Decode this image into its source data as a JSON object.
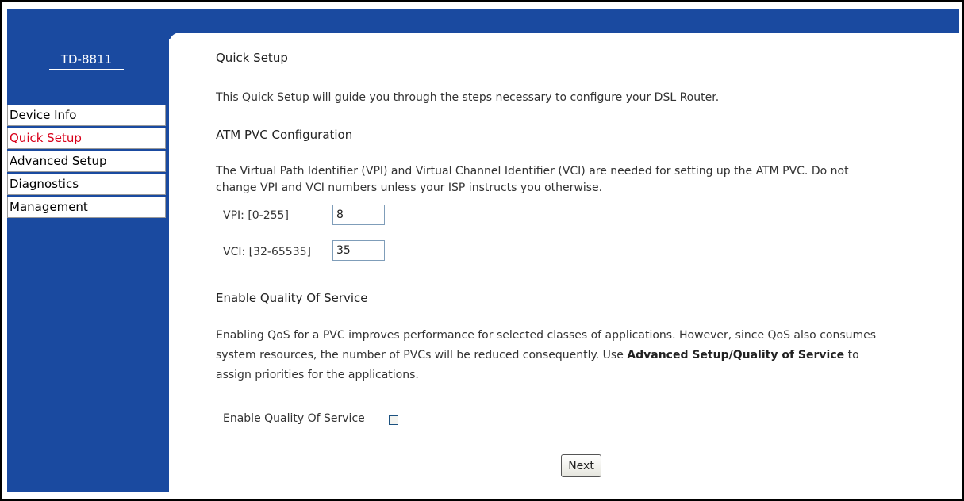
{
  "brand": {
    "model": "TD-8811"
  },
  "menu": [
    {
      "label": "Device Info",
      "active": false
    },
    {
      "label": "Quick Setup",
      "active": true
    },
    {
      "label": "Advanced Setup",
      "active": false
    },
    {
      "label": "Diagnostics",
      "active": false
    },
    {
      "label": "Management",
      "active": false
    }
  ],
  "page": {
    "title": "Quick Setup",
    "intro": "This Quick Setup will guide you through the steps necessary to configure your DSL Router.",
    "atm": {
      "heading": "ATM PVC Configuration",
      "description_line1": "The Virtual Path Identifier (VPI) and Virtual Channel Identifier (VCI) are needed for setting up the ATM PVC. Do not",
      "description_line2": "change VPI and VCI numbers unless your ISP instructs you otherwise.",
      "vpi_label": "VPI: [0-255]",
      "vpi_value": "8",
      "vci_label": "VCI: [32-65535]",
      "vci_value": "35"
    },
    "qos": {
      "heading": "Enable Quality Of Service",
      "desc_line1": "Enabling QoS for a PVC improves performance for selected classes of applications. However, since QoS also consumes",
      "desc_line2_pre": "system resources, the number of PVCs will be reduced consequently. Use ",
      "desc_line2_bold": "Advanced Setup/Quality of Service",
      "desc_line2_post": " to",
      "desc_line3": "assign priorities for the applications.",
      "checkbox_label": "Enable Quality Of Service",
      "checked": false
    },
    "next_label": "Next"
  },
  "colors": {
    "accent": "#1a4aa0",
    "active_menu": "#d8001a"
  }
}
